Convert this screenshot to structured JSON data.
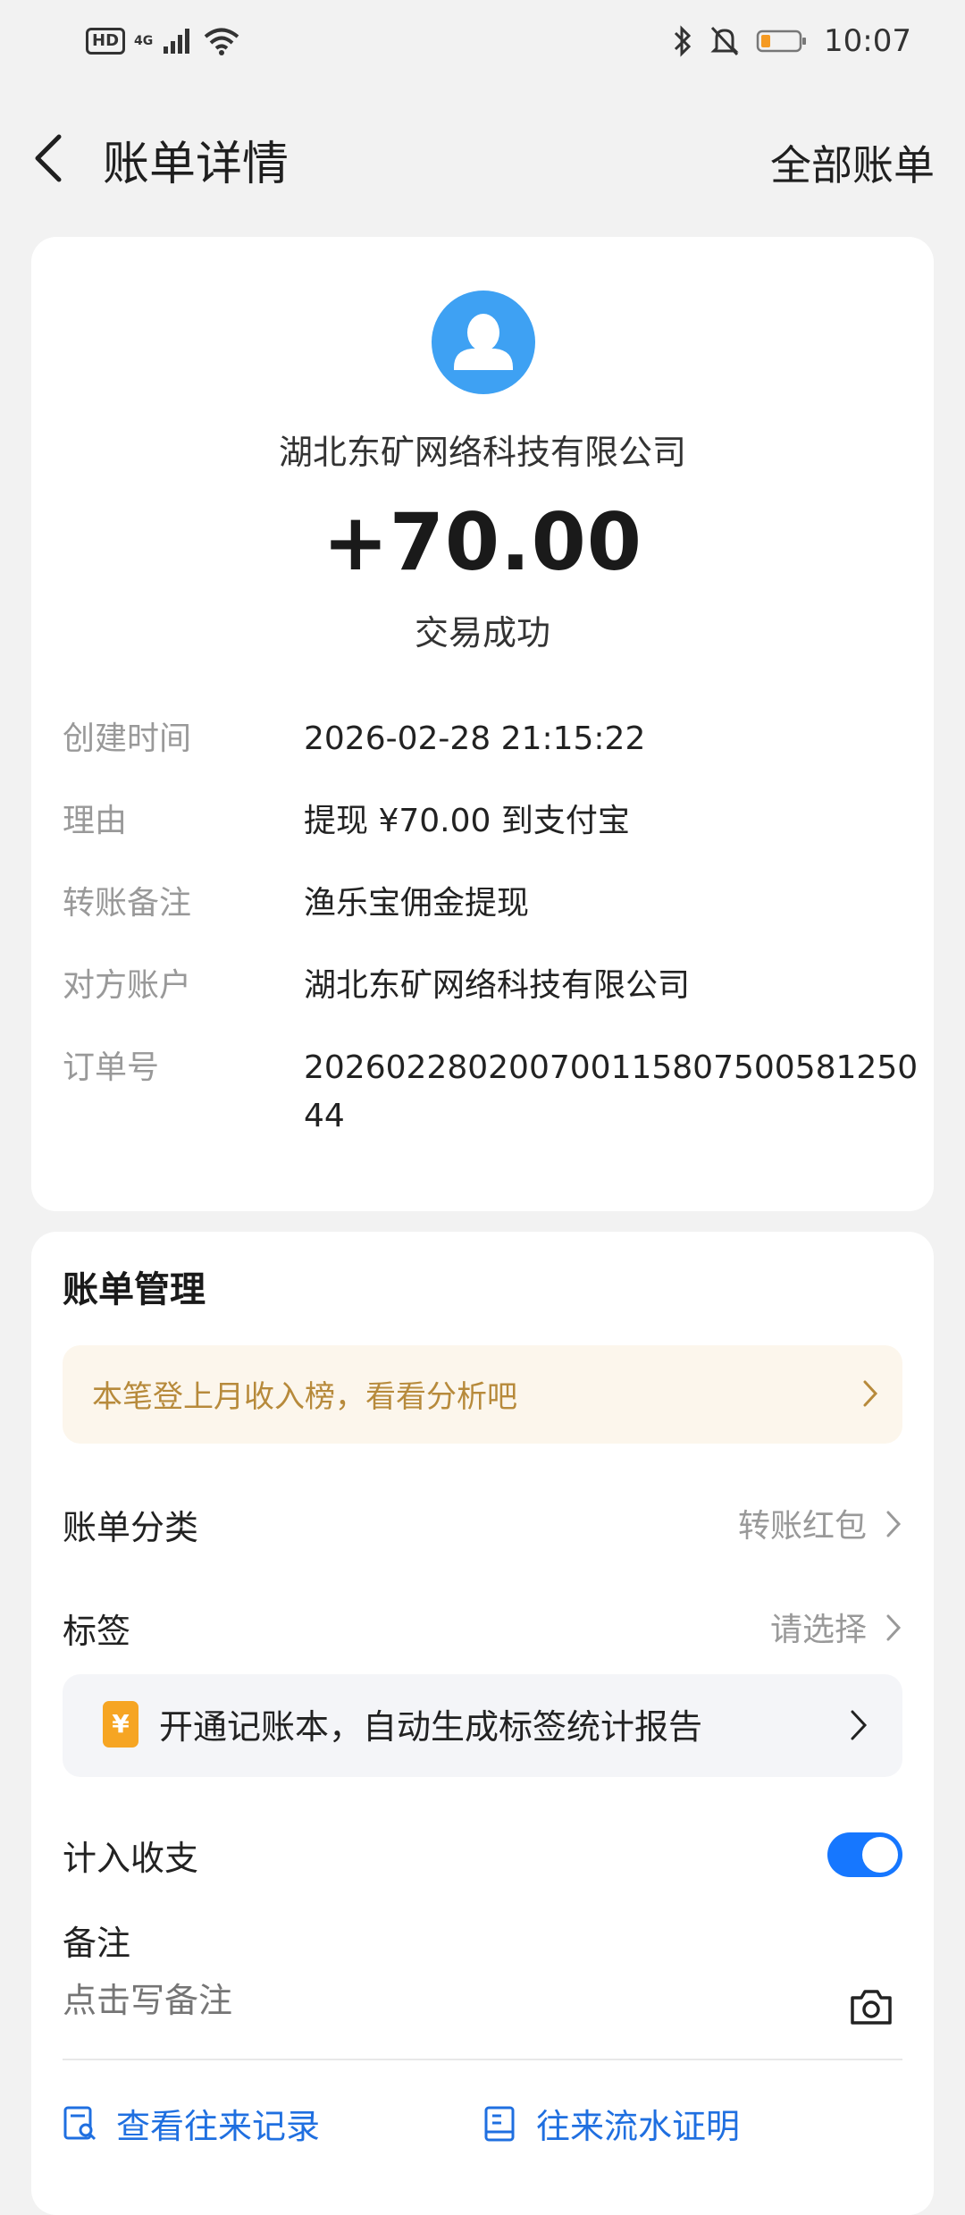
{
  "status_bar": {
    "hd": "HD",
    "network": "4G",
    "time": "10:07"
  },
  "header": {
    "title": "账单详情",
    "all_bills": "全部账单"
  },
  "bill": {
    "counterparty": "湖北东矿网络科技有限公司",
    "amount": "+70.00",
    "status": "交易成功",
    "details": [
      {
        "label": "创建时间",
        "value": "2026-02-28 21:15:22"
      },
      {
        "label": "理由",
        "value": "提现 ¥70.00 到支付宝"
      },
      {
        "label": "转账备注",
        "value": "渔乐宝佣金提现"
      },
      {
        "label": "对方账户",
        "value": "湖北东矿网络科技有限公司"
      },
      {
        "label": "订单号",
        "value": "202602280200700115807500581250 44"
      }
    ]
  },
  "management": {
    "title": "账单管理",
    "promo": "本笔登上月收入榜，看看分析吧",
    "category_label": "账单分类",
    "category_value": "转账红包",
    "tag_label": "标签",
    "tag_value": "请选择",
    "tagbook_icon": "¥",
    "tagbook_text": "开通记账本，自动生成标签统计报告",
    "include_label": "计入收支",
    "include_enabled": true,
    "note_label": "备注",
    "note_placeholder": "点击写备注",
    "link_records": "查看往来记录",
    "link_proof": "往来流水证明"
  },
  "colors": {
    "accent": "#1677ff",
    "link": "#1f6fe0",
    "avatar": "#3ea1f3",
    "promo_text": "#b78a3b"
  }
}
